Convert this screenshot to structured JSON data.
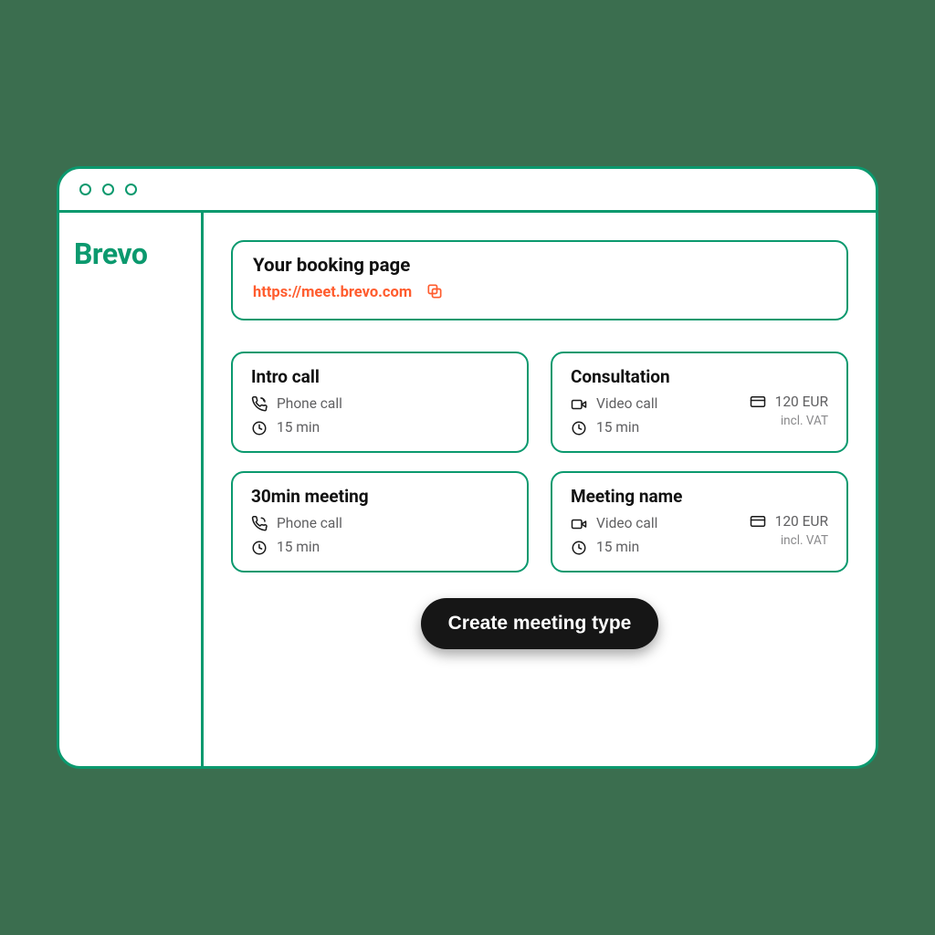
{
  "brand": "Brevo",
  "booking": {
    "title": "Your booking page",
    "url": "https://meet.brevo.com"
  },
  "meetings": [
    {
      "title": "Intro call",
      "mode": "Phone call",
      "mode_icon": "phone",
      "duration": "15 min"
    },
    {
      "title": "Consultation",
      "mode": "Video call",
      "mode_icon": "video",
      "duration": "15 min",
      "price": "120 EUR",
      "price_note": "incl. VAT"
    },
    {
      "title": "30min meeting",
      "mode": "Phone call",
      "mode_icon": "phone",
      "duration": "15 min"
    },
    {
      "title": "Meeting name",
      "mode": "Video call",
      "mode_icon": "video",
      "duration": "15 min",
      "price": "120 EUR",
      "price_note": "incl. VAT"
    }
  ],
  "actions": {
    "create_label": "Create meeting type"
  }
}
